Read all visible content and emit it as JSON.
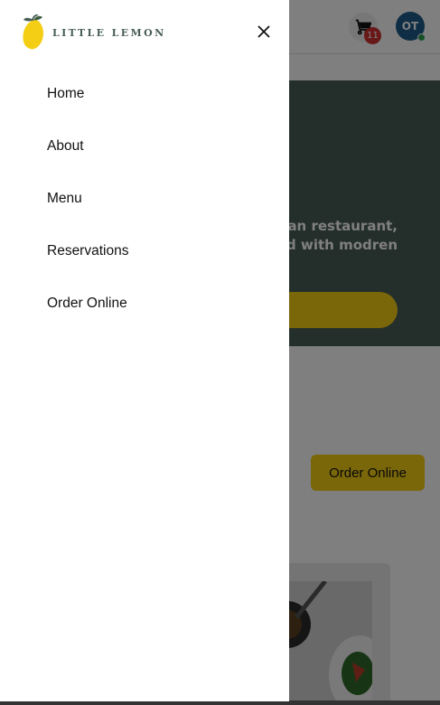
{
  "brand": {
    "name": "LITTLE LEMON",
    "accent": "#f4ce14",
    "primary": "#495e57"
  },
  "header": {
    "cart_icon": "shopping-cart-icon",
    "cart_count": "11",
    "avatar_initials": "OT"
  },
  "hero": {
    "text_line1": "ean restaurant,",
    "text_line2": "ed with modren"
  },
  "main": {
    "order_button_label": "Order Online"
  },
  "drawer": {
    "close_icon": "close-icon",
    "items": [
      {
        "label": "Home"
      },
      {
        "label": "About"
      },
      {
        "label": "Menu"
      },
      {
        "label": "Reservations"
      },
      {
        "label": "Order Online"
      }
    ]
  }
}
